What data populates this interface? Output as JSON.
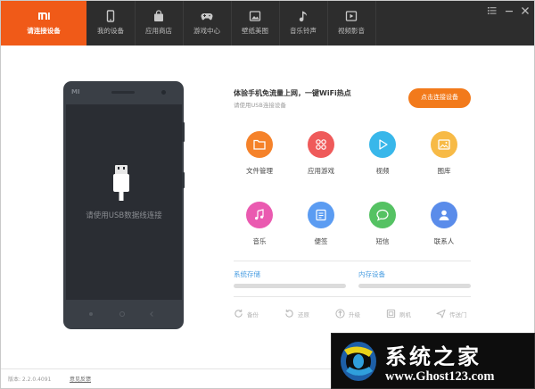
{
  "nav": {
    "tabs": [
      {
        "label": "请连接设备",
        "icon": "mi-logo-icon",
        "active": true
      },
      {
        "label": "我的设备",
        "icon": "phone-icon"
      },
      {
        "label": "应用商店",
        "icon": "shopping-bag-icon"
      },
      {
        "label": "游戏中心",
        "icon": "gamepad-icon"
      },
      {
        "label": "壁纸美图",
        "icon": "picture-icon"
      },
      {
        "label": "音乐铃声",
        "icon": "music-note-icon"
      },
      {
        "label": "视频影音",
        "icon": "video-play-icon"
      }
    ],
    "logo_text": "MI"
  },
  "phone": {
    "brand": "MI",
    "usb_hint": "请使用USB数据线连接"
  },
  "wifi": {
    "title": "体验手机免流量上网，一键WiFi热点",
    "subtitle": "请使用USB连接设备",
    "connect_button": "点击连接设备"
  },
  "apps": [
    {
      "label": "文件管理",
      "icon": "folder-icon",
      "color": "#f5822a"
    },
    {
      "label": "应用游戏",
      "icon": "app-grid-icon",
      "color": "#ef5a5a"
    },
    {
      "label": "视频",
      "icon": "video-play-icon",
      "color": "#38b7ea"
    },
    {
      "label": "图库",
      "icon": "gallery-icon",
      "color": "#f7ba46"
    },
    {
      "label": "音乐",
      "icon": "music-note-icon",
      "color": "#ea5ab0"
    },
    {
      "label": "便签",
      "icon": "note-icon",
      "color": "#5b9cf2"
    },
    {
      "label": "短信",
      "icon": "chat-bubble-icon",
      "color": "#55c263"
    },
    {
      "label": "联系人",
      "icon": "contact-icon",
      "color": "#5a8cea"
    }
  ],
  "storage": {
    "system_label": "系统存储",
    "system_used": 0,
    "memory_label": "内存设备",
    "memory_used": 0
  },
  "toolbar": [
    {
      "label": "备份",
      "icon": "backup-icon"
    },
    {
      "label": "还原",
      "icon": "restore-icon"
    },
    {
      "label": "升级",
      "icon": "upgrade-icon"
    },
    {
      "label": "刷机",
      "icon": "flash-icon"
    },
    {
      "label": "传送门",
      "icon": "send-icon"
    }
  ],
  "footer": {
    "version": "版本: 2.2.0.4091",
    "feedback": "意见反馈"
  },
  "watermark": {
    "title": "系统之家",
    "url": "www.Ghost123.com"
  },
  "colors": {
    "accent": "#f05a18",
    "topbar": "#2d2d2d",
    "link": "#4a9ee2"
  }
}
